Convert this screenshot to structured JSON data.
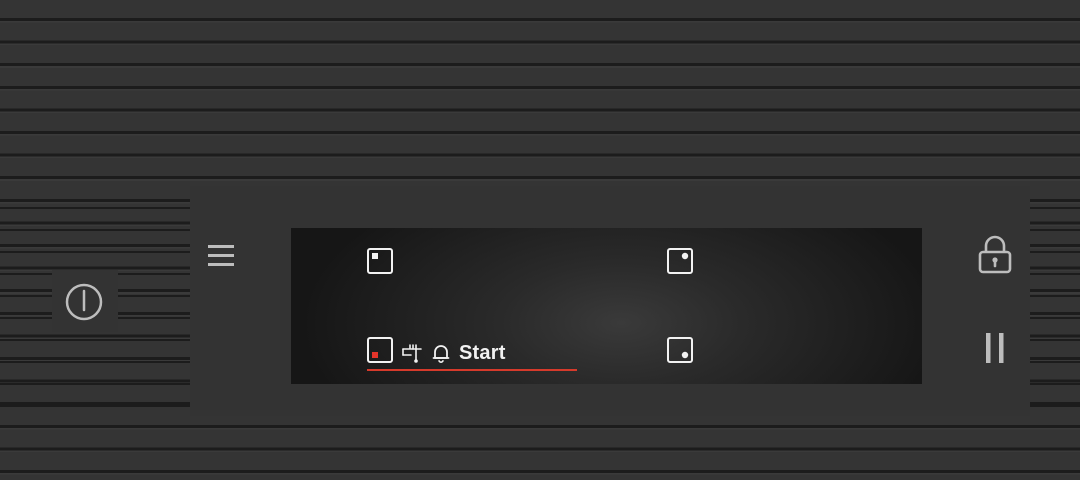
{
  "colors": {
    "background": "#2f2f2f",
    "icon": "#bdbdbd",
    "display_bg": "#161616",
    "display_icon": "#f2f2f2",
    "accent_red": "#d63a2b"
  },
  "controls": {
    "power_icon": "power-icon",
    "menu_icon": "hamburger-menu-icon",
    "lock_icon": "lock-icon",
    "pause_icon": "pause-icon"
  },
  "display": {
    "zones": [
      {
        "name": "top-left",
        "icon": "cooking-zone-top-left-icon",
        "active": false
      },
      {
        "name": "top-right",
        "icon": "cooking-zone-top-right-icon",
        "active": false
      },
      {
        "name": "bottom-left",
        "icon": "cooking-zone-bottom-left-icon",
        "active": true
      },
      {
        "name": "bottom-right",
        "icon": "cooking-zone-bottom-right-icon",
        "active": false
      }
    ],
    "selected_zone_icon": "temperature-sensor-icon",
    "timer_icon": "bell-icon",
    "start_label": "Start"
  }
}
